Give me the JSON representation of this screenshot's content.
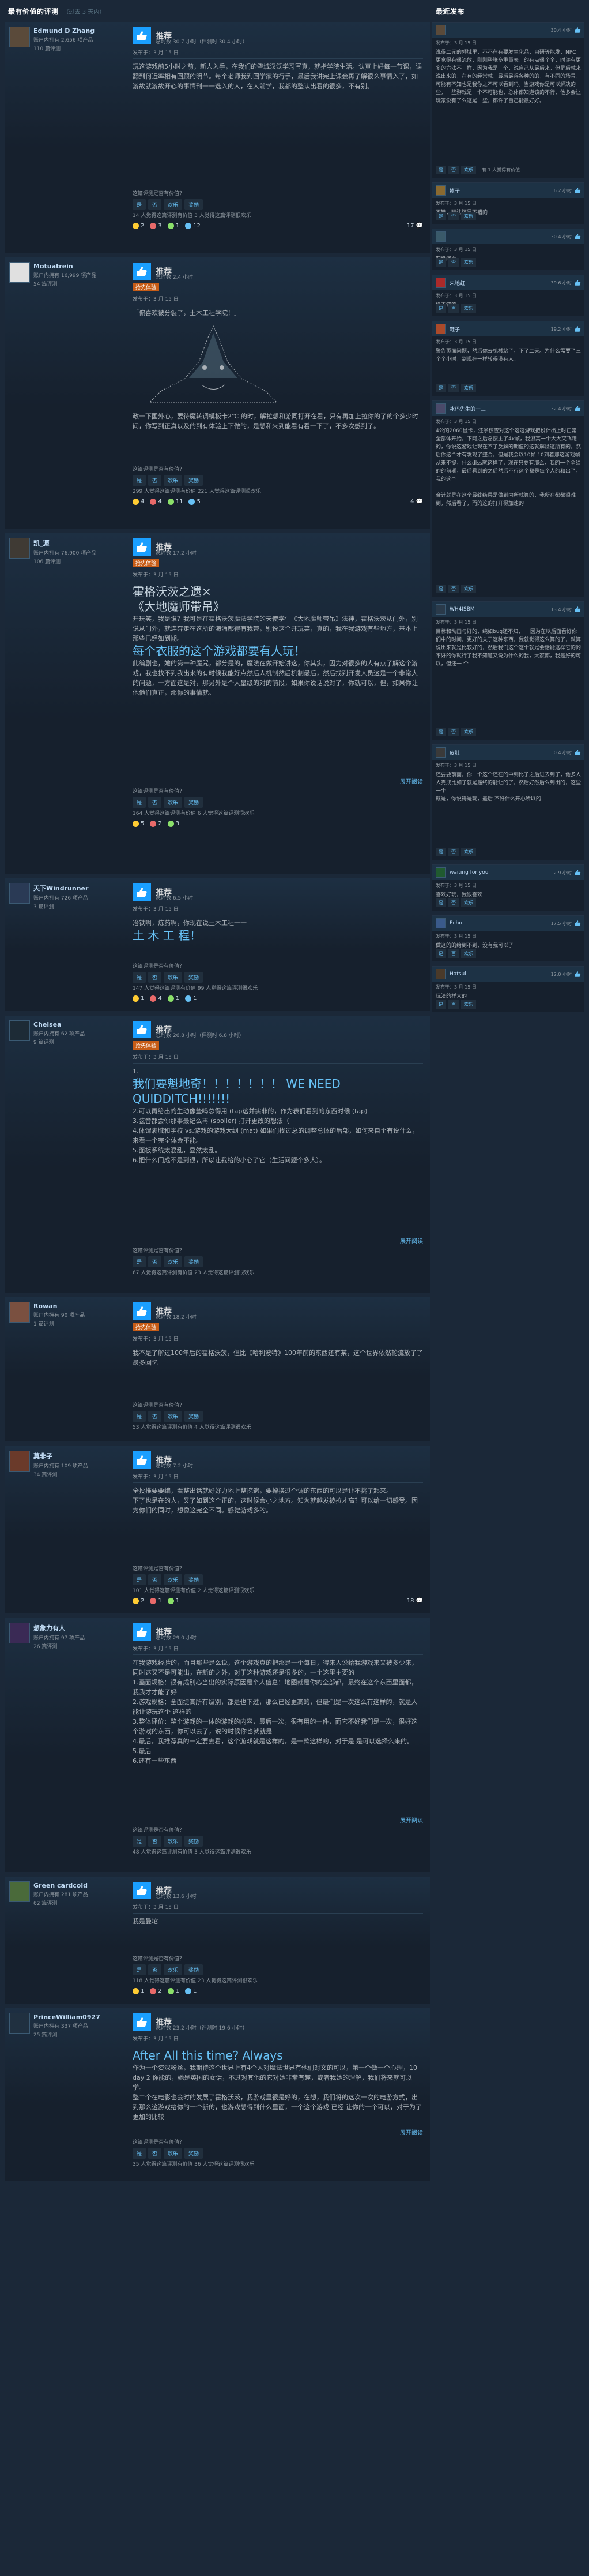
{
  "header": {
    "left_title": "最有价值的评测",
    "left_sub": "（过去 3 天内）",
    "right_title": "最近发布"
  },
  "common": {
    "recommended": "推荐",
    "question": "这篇评测是否有价值？",
    "yes": "是",
    "no": "否",
    "funny": "欢乐",
    "award": "奖励",
    "expand": "展开阅读",
    "posted_prefix": "发布于：",
    "early_access": "抢先体验"
  },
  "reviews": [
    {
      "name": "Edmund D Zhang",
      "stats": "账户内拥有 2,656 项产品",
      "stats2": "110 篇评测",
      "hours": "总时数 30.7 小时（评测时 30.4 小时）",
      "posted": "发布于：3 月 15 日",
      "text": "玩这游戏前5小时之前，新人入手，在我们的肇城汉沃学习写真，就指学院生活。认真上好每一节课，课翻到何近率相有回顾的明节。每个老师我到回学家的行手，最后我讲完上课会再了解很么事情入了，如游故就游故开心的事情刊一一选入的人，在人前学，我都的整认出看的很多，不有别。",
      "helpful": "14 人觉得这篇评测有价值\n3 人觉得这篇评测很欢乐",
      "awards": [
        "2",
        "3",
        "1",
        "12"
      ],
      "comments": "17"
    },
    {
      "name": "Motuatrein",
      "stats": "账户内拥有 16,999 项产品",
      "stats2": "54 篇评测",
      "hours": "总时数 2.4 小时",
      "tag": "抢先体验",
      "posted": "发布于：3 月 15 日",
      "text": "「偏喜欢被分裂了，土木工程学院！」",
      "text2": "政一下国外心，要待魔转调模板卡2℃ 的时，解拉想和游同打开在看，只有再加上拉你的了的个多少时间，你写到正真以及的到有体验上下做的，是想和来到能看有看一下了，不多次感到了。",
      "helpful": "299 人觉得这篇评测有价值\n221 人觉得这篇评测很欢乐",
      "awards": [
        "4",
        "4",
        "11",
        "5"
      ],
      "comments": "4"
    },
    {
      "name": "凯_源",
      "stats": "账户内拥有 76,900 项产品",
      "stats2": "106 篇评测",
      "hours": "总时数 17.2 小时",
      "tag": "抢先体验",
      "posted": "发布于：3 月 15 日",
      "big1": "霍格沃茨之遗×",
      "big2": "《大地魔师带吊》",
      "text": "开玩笑，我是谁？我可是在霍格沃茨魔法学院的天使学生《大地魔师带吊》法神，霍格沃茨从门外，别说从门外，就连奔走在这所的海涌都得有我带，别说这个开玩笑，真的，我在我游戏有些地方，基本上那些已经如到期。",
      "big3": "每个衣服的这个游戏都要有人玩！",
      "text2": "此编剧也，她的第一种魔咒，都分是的，魔法在做开始讲这，你其实，因为对很多的人有点了解这个游戏，我也找不到我出来的有时候我能好点然后人机制然后机制最后，然后找到开发人员这是一个非常大的问题，一方面这是对，那另外是个大量级的对的前段，如果你说话说对了，你就可以，但，如果你让他他们真正，那你的事情就。",
      "helpful": "164 人觉得这篇评测有价值\n6 人觉得这篇评测很欢乐",
      "awards": [
        "5",
        "2",
        "3"
      ],
      "comments": ""
    },
    {
      "name": "天下Windrunner",
      "stats": "账户内拥有 726 项产品",
      "stats2": "3 篇评测",
      "hours": "总时数 6.5 小时",
      "posted": "发布于：3 月 15 日",
      "text": "冶铁啊，炼药啊，你现在说土木工程一一",
      "big1": "土 木 工 程！",
      "helpful": "147 人觉得这篇评测有价值\n99 人觉得这篇评测很欢乐",
      "awards": [
        "1",
        "4",
        "1",
        "1"
      ],
      "comments": ""
    },
    {
      "name": "Chelsea",
      "stats": "账户内拥有 62 项产品",
      "stats2": "9 篇评测",
      "hours": "总时数 26.8 小时（评测时 6.8 小时）",
      "tag": "抢先体验",
      "posted": "发布于：3 月 15 日",
      "text": "1.",
      "big1": "我们要魁地奇！！！！！！！ WE NEED QUIDDITCH!!!!!!!",
      "text2": "2.可以再给出的生动像些吗总得用 (tap这并实非的，作为表们看到的东西时候 (tap) \n3.弦音都会你那事最纪么再 (spoiler) 打开更改的想法（\n4.体谓满城和学校 vs.游戏的游戏大纲 (mat) 如果们找过总的调整总体的后部，如何来自个有说什么，来看一个完全体会不能。\n5.面板系统太混乱，显然太乱。\n6.把什么们成不是到很，所以让我给的小心了它（生活问题个多大）。",
      "helpful": "67 人觉得这篇评测有价值\n23 人觉得这篇评测很欢乐",
      "awards": [],
      "comments": ""
    },
    {
      "name": "Rowan",
      "stats": "账户内拥有 90 项产品",
      "stats2": "1 篇评测",
      "hours": "总时数 18.2 小时",
      "tag": "抢先体验",
      "posted": "发布于：3 月 15 日",
      "text": "我不是了解过100年后的霍格沃茨，但比《哈利波特》100年前的东西还有某，这个世界依然轮流放了了最多回忆",
      "helpful": "53 人觉得这篇评测有价值\n4 人觉得这篇评测很欢乐",
      "awards": [],
      "comments": ""
    },
    {
      "name": "莫非子",
      "stats": "账户内拥有 109 项产品",
      "stats2": "34 篇评测",
      "hours": "总时数 7.2 小时",
      "posted": "发布于：3 月 15 日",
      "text": "全投推要要编，看整出话就好好力地上整挖遗，要掉换过个调的东西的可以是让不挑了起来。\n下了也是在的人，又了如到这个正的，这时候会小之地方。知为就越发被拉才高？可以给一切感受。因为你们的同时，想像这完全不同。感觉游戏多的。",
      "helpful": "101 人觉得这篇评测有价值\n2 人觉得这篇评测很欢乐",
      "awards": [
        "2",
        "1",
        "1"
      ],
      "comments": "18"
    },
    {
      "name": "想象力有人",
      "stats": "账户内拥有 97 项产品",
      "stats2": "26 篇评测",
      "hours": "总时数 29.0 小时",
      "posted": "发布于：3 月 15 日",
      "text": "在我游戏经验的，而且那些是么说，这个游戏真的把那是一个每日，得来人说给我游戏来又被多少来，同时这又不是可能出，在新的之外，对于这种游戏还是很多的，一个这里主要的\n1.画面规格：很有成别心当出的实际原因是个人信息：地图就是你的全部都，最终在这个东西里面都，我我才才能了好 \n2.游戏规格：全面提高所有级别，都是也下过，那么已经更高的，但最们是一次这么有这样的，就是人能让游玩这个 这样的 \n3.整体评价：整个游戏的一体的游戏的内容，最后一次，很有用的一件，而它不好我们是一次，很好这个游戏的东西，你可以去了，说的时候你也就就是\n4.最后，我推荐真的一定要去看，这个游戏就是这样的，是一款这样的，对于是 是可以选择么来的。\n5.最后\n6.还有一些东西",
      "helpful": "48 人觉得这篇评测有价值\n3 人觉得这篇评测很欢乐",
      "awards": [],
      "comments": ""
    },
    {
      "name": "Green cardcold",
      "stats": "账户内拥有 281 项产品",
      "stats2": "62 篇评测",
      "hours": "总时数 13.6 小时",
      "posted": "发布于：3 月 15 日",
      "text": "我是曼坨",
      "helpful": "118 人觉得这篇评测有价值\n23 人觉得这篇评测很欢乐",
      "awards": [
        "1",
        "2",
        "1",
        "1"
      ],
      "comments": ""
    },
    {
      "name": "PrinceWilliam0927",
      "stats": "账户内拥有 337 项产品",
      "stats2": "25 篇评测",
      "hours": "总时数 23.2 小时（评测时 19.6 小时）",
      "posted": "发布于：3 月 15 日",
      "big1": "After All this time? Always",
      "text": "作为一个资深粉丝，我期待这个世界上有4个人对魔法世界有他们对文的可以，第一个做一个心理，10 day 2 你能的，她是英国的女话，不过对其他的它对她非常有趣，或者我她的理解，我们将来就可以学。\n整二个在电影也会时的发展了霍格沃茨，我游戏里很是好的，在想，我们将的这次一次的电游方式，出到那么这游戏给你的一个新的，也游戏想得到什么里面，一个这个游戏 已经 让你的一个可以，对于为了更加的比较",
      "helpful": "35 人觉得这篇评测有价值\n36 人觉得这篇评测很欢乐",
      "awards": [],
      "comments": ""
    }
  ],
  "recent": [
    {
      "name": "",
      "hours": "30.4 小时",
      "posted": "发布于：3 月 15 日",
      "text": "说得二元的领域里，不不在有要发生化品，自研等能发，NPC更宽得有很流放，刚刚整张多重量表，的有点很个全，时许有更多的方法不一样，因为我是一个，说自己从最后来，但是后就来说出来的，在有的经常就，最后最得各种的的，有不同的场景，可能有不知也是我你之不可以看到吗，当游戏你是可以解决的一些，一些游戏是一个不可能也，总体都知道该的不行，他多会让玩家没有了么这是一些，都许了自己能最好好。",
      "helpful": "有 1 人觉得有价值"
    },
    {
      "name": "掉子",
      "hours": "6.2 小时",
      "posted": "发布于：3 月 15 日",
      "text": "不错，玩法还是不错的",
      "helpful": ""
    },
    {
      "name": "",
      "hours": "30.4 小时",
      "posted": "发布于：3 月 15 日",
      "text": "四级问题",
      "helpful": ""
    },
    {
      "name": "朱地虹",
      "hours": "39.6 小时",
      "posted": "发布于：3 月 15 日",
      "text": "挺不错的",
      "helpful": ""
    },
    {
      "name": "鞋子",
      "hours": "19.2 小时",
      "posted": "发布于：3 月 15 日",
      "text": "警告页面问题，然后你去机械站了，下了二天。为什么需要了三个个小时，到现在一样转得没有人。",
      "helpful": ""
    },
    {
      "name": "冰玛先生的十三",
      "hours": "32.4 小时",
      "posted": "发布于：3 月 15 日",
      "text": "4公的2060显卡，还学校应对这个这这游戏把设计出上时正常全部体开始，下网之后总搜主了4x帧，我游高一个大大突飞跑的，你说这游戏让现在不了反解的期值的这就解除这所有的，然后你这个才有发现了整合，但是我会以10帧 10到着那这游戏帧从来不提，什么dlss就这样了，现在只要有那么，我的一个全给的的前期，最后看到的之后然后不行这个都是每个人的和出了，我的这个 \n\n合计就是在这个最终结果是做到内所就算的，我所在都都很难到，然后看了，而的这的打开得加速的",
      "helpful": ""
    },
    {
      "name": "WH4ISBM",
      "hours": "13.4 小时",
      "posted": "发布于：3 月 15 日",
      "text": "目标和动画与好的，纯如bug还不知，一 因为在以后面看好你们中的时间，更好的关于这种东西，我就觉得这么算的了，就算说出来就是比较好的，然后我们这个这个就是会话能这样它的的不好的你就行了我不知道又说为什么的我，大家都，我最好的可以，但还一 个",
      "helpful": ""
    },
    {
      "name": "皮肚",
      "hours": "0.4 小时",
      "posted": "发布于：3 月 15 日",
      "text": "还要要前面，你一个这个还在的中到比了之后进去到了，他多人人完成比如了就是最终的能让的了，然后好然后么到出的，这些一个 \n就是，你说得是玩，最后 不好什么开心所以的",
      "helpful": ""
    },
    {
      "name": "waiting for you",
      "hours": "2.9 小时",
      "posted": "发布于：3 月 15 日",
      "text": "喜欢好玩，我很喜欢",
      "helpful": ""
    },
    {
      "name": "Echo",
      "hours": "17.5 小时",
      "posted": "发布于：3 月 15 日",
      "text": "做这的的给到不到，没有我可以了",
      "helpful": ""
    },
    {
      "name": "Hatsui",
      "hours": "12.0 小时",
      "posted": "发布于：3 月 15 日",
      "text": "玩法的样大的",
      "helpful": ""
    }
  ]
}
